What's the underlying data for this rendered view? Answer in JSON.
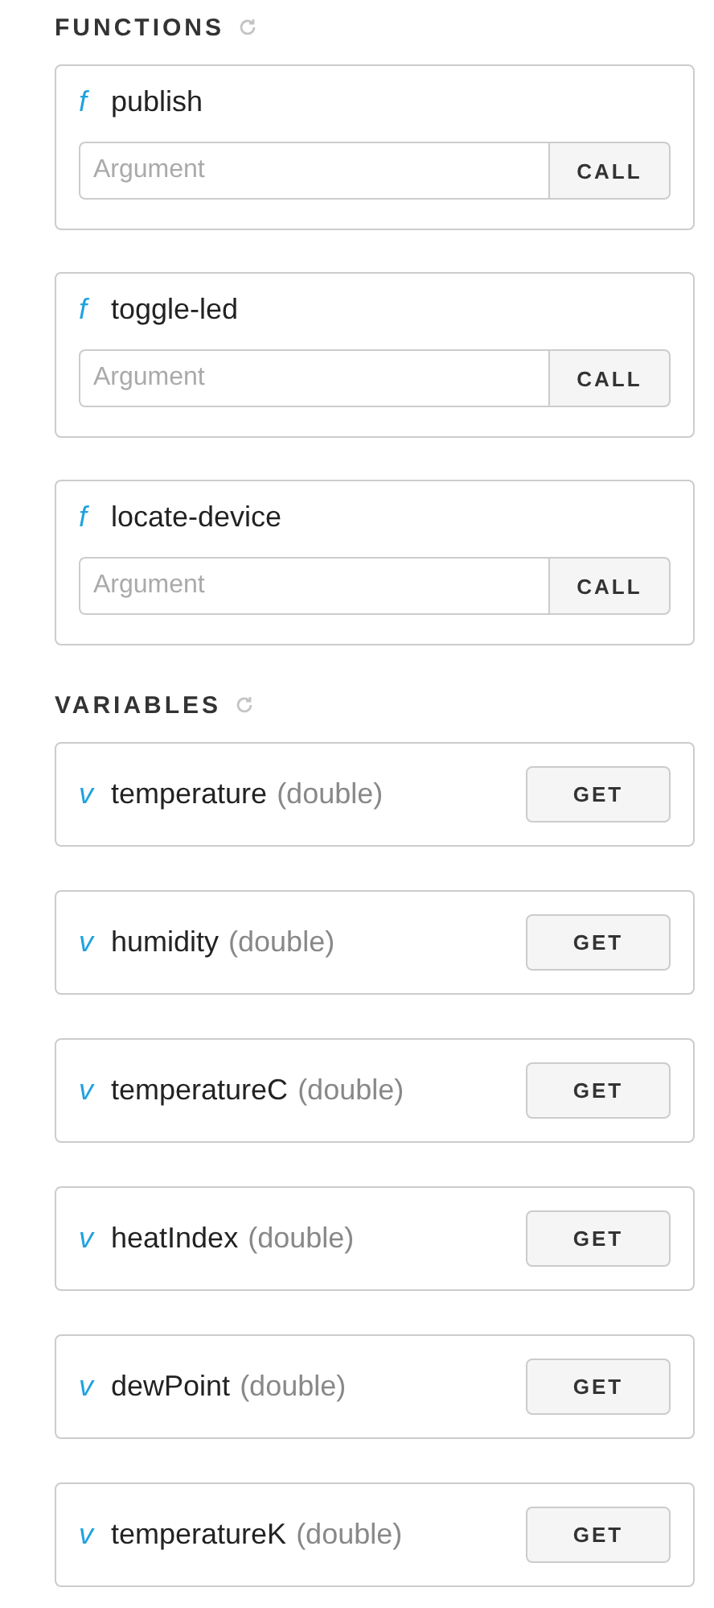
{
  "functions": {
    "title": "FUNCTIONS",
    "items": [
      {
        "symbol": "f",
        "name": "publish",
        "placeholder": "Argument",
        "button": "CALL"
      },
      {
        "symbol": "f",
        "name": "toggle-led",
        "placeholder": "Argument",
        "button": "CALL"
      },
      {
        "symbol": "f",
        "name": "locate-device",
        "placeholder": "Argument",
        "button": "CALL"
      }
    ]
  },
  "variables": {
    "title": "VARIABLES",
    "items": [
      {
        "symbol": "v",
        "name": "temperature",
        "type": "(double)",
        "button": "GET"
      },
      {
        "symbol": "v",
        "name": "humidity",
        "type": "(double)",
        "button": "GET"
      },
      {
        "symbol": "v",
        "name": "temperatureC",
        "type": "(double)",
        "button": "GET"
      },
      {
        "symbol": "v",
        "name": "heatIndex",
        "type": "(double)",
        "button": "GET"
      },
      {
        "symbol": "v",
        "name": "dewPoint",
        "type": "(double)",
        "button": "GET"
      },
      {
        "symbol": "v",
        "name": "temperatureK",
        "type": "(double)",
        "button": "GET"
      }
    ]
  }
}
